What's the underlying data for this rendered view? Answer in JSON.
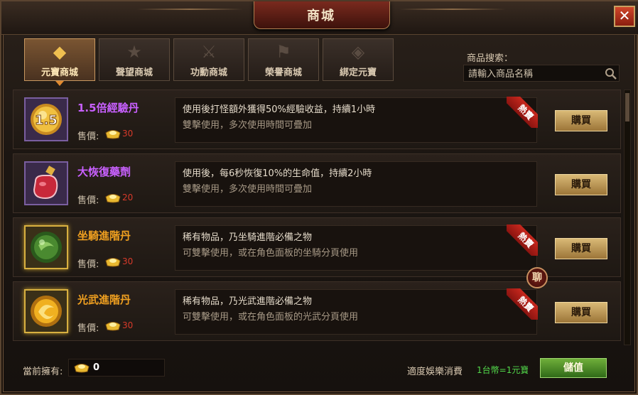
{
  "window": {
    "title": "商城"
  },
  "tabs": [
    {
      "label": "元寶商城",
      "active": true
    },
    {
      "label": "聲望商城",
      "active": false
    },
    {
      "label": "功勳商城",
      "active": false
    },
    {
      "label": "榮譽商城",
      "active": false
    },
    {
      "label": "綁定元寶",
      "active": false
    }
  ],
  "search": {
    "label": "商品搜索：",
    "placeholder": "請輸入商品名稱"
  },
  "items": [
    {
      "name": "1.5倍經驗丹",
      "name_color": "#c860ff",
      "price_label": "售價:",
      "price": "30",
      "desc1": "使用後打怪額外獲得50%經驗收益，持續1小時",
      "desc2": "雙擊使用，多次使用時間可疊加",
      "hot": true,
      "hot_label": "熱賣",
      "buy_label": "購買",
      "icon": "exp-pill-icon",
      "icon_text": "1.5"
    },
    {
      "name": "大恢復藥劑",
      "name_color": "#c860ff",
      "price_label": "售價:",
      "price": "20",
      "desc1": "使用後，每6秒恢復10%的生命值，持續2小時",
      "desc2": "雙擊使用，多次使用時間可疊加",
      "hot": false,
      "hot_label": "",
      "buy_label": "購買",
      "icon": "potion-icon"
    },
    {
      "name": "坐騎進階丹",
      "name_color": "#f0a020",
      "price_label": "售價:",
      "price": "30",
      "desc1": "稀有物品，乃坐騎進階必備之物",
      "desc2": "可雙擊使用，或在角色面板的坐騎分頁使用",
      "hot": true,
      "hot_label": "熱賣",
      "buy_label": "購買",
      "icon": "mount-pill-icon"
    },
    {
      "name": "光武進階丹",
      "name_color": "#f0a020",
      "price_label": "售價:",
      "price": "30",
      "desc1": "稀有物品，乃光武進階必備之物",
      "desc2": "可雙擊使用，或在角色面板的光武分頁使用",
      "hot": true,
      "hot_label": "熱賣",
      "buy_label": "購買",
      "icon": "weapon-pill-icon"
    }
  ],
  "chat": {
    "label": "聊"
  },
  "footer": {
    "balance_label": "當前擁有:",
    "balance": "0",
    "notice": "適度娛樂消費",
    "rate": "1台幣=1元寶",
    "recharge_label": "儲值"
  },
  "colors": {
    "price": "#d83a2a",
    "rate": "#52d84a",
    "accent": "#e08a30"
  }
}
